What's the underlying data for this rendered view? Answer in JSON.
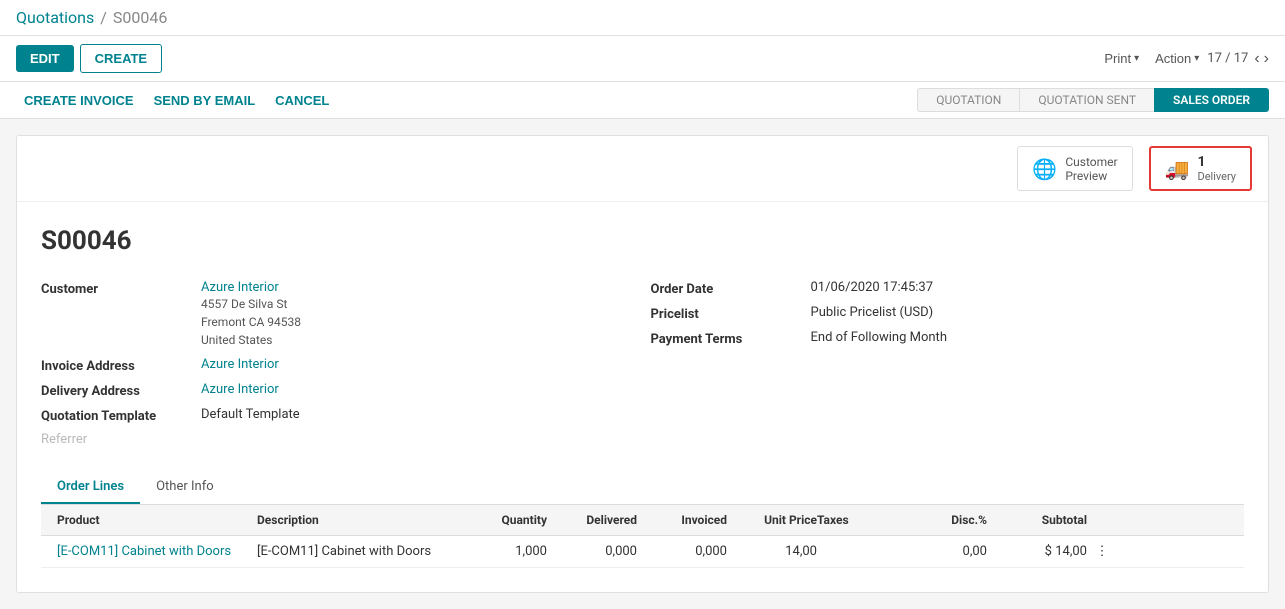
{
  "breadcrumb": {
    "parent": "Quotations",
    "separator": "/",
    "current": "S00046"
  },
  "toolbar": {
    "edit_label": "EDIT",
    "create_label": "CREATE",
    "print_label": "Print",
    "action_label": "Action",
    "pagination": "17 / 17"
  },
  "action_bar": {
    "create_invoice_label": "CREATE INVOICE",
    "send_by_email_label": "SEND BY EMAIL",
    "cancel_label": "CANCEL"
  },
  "status_steps": [
    {
      "label": "QUOTATION",
      "state": "default"
    },
    {
      "label": "QUOTATION SENT",
      "state": "default"
    },
    {
      "label": "SALES ORDER",
      "state": "active"
    }
  ],
  "smart_buttons": [
    {
      "id": "customer-preview",
      "icon": "🌐",
      "label": "Customer\nPreview",
      "count": null,
      "highlighted": false
    },
    {
      "id": "delivery",
      "icon": "🚚",
      "count": "1",
      "label": "Delivery",
      "highlighted": true
    }
  ],
  "record": {
    "title": "S00046",
    "customer_label": "Customer",
    "customer_name": "Azure Interior",
    "customer_address_line1": "4557 De Silva St",
    "customer_address_line2": "Fremont CA 94538",
    "customer_address_line3": "United States",
    "invoice_address_label": "Invoice Address",
    "invoice_address": "Azure Interior",
    "delivery_address_label": "Delivery Address",
    "delivery_address": "Azure Interior",
    "quotation_template_label": "Quotation Template",
    "quotation_template": "Default Template",
    "referrer_label": "Referrer",
    "referrer_placeholder": "",
    "order_date_label": "Order Date",
    "order_date": "01/06/2020 17:45:37",
    "pricelist_label": "Pricelist",
    "pricelist": "Public Pricelist (USD)",
    "payment_terms_label": "Payment Terms",
    "payment_terms": "End of Following Month"
  },
  "tabs": [
    {
      "label": "Order Lines",
      "active": true
    },
    {
      "label": "Other Info",
      "active": false
    }
  ],
  "table": {
    "columns": [
      "Product",
      "Description",
      "Quantity",
      "Delivered",
      "Invoiced",
      "Unit Price",
      "Taxes",
      "Disc.%",
      "Subtotal",
      ""
    ],
    "rows": [
      {
        "product": "[E-COM11] Cabinet with Doors",
        "description": "[E-COM11] Cabinet with Doors",
        "quantity": "1,000",
        "delivered": "0,000",
        "invoiced": "0,000",
        "unit_price": "14,00",
        "taxes": "",
        "disc": "0,00",
        "subtotal": "$ 14,00"
      }
    ]
  }
}
